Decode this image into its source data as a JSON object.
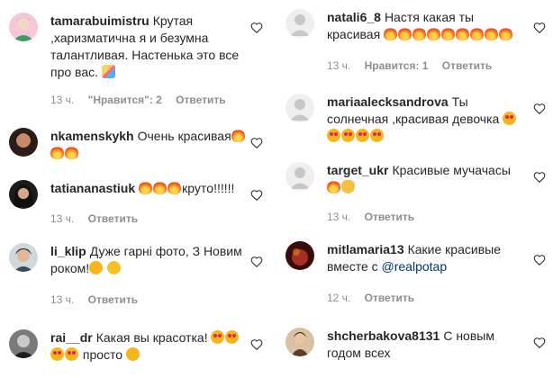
{
  "left_comments": [
    {
      "username": "tamarabuimistru",
      "text": "Крутая ,харизматична я и безумна талантливая. Настенька это все про вас.",
      "emojis": [
        "party-popper-icon"
      ],
      "time": "13 ч.",
      "likes": "\"Нравится\": 2",
      "reply": "Ответить",
      "avatar_colors": [
        "#f6c7d8",
        "#3a9a6a"
      ]
    },
    {
      "username": "nkamenskykh",
      "text": "Очень красивая",
      "emojis": [
        "fire-icon",
        "fire-icon",
        "fire-icon"
      ],
      "time": "",
      "likes": "",
      "reply": "",
      "avatar_colors": [
        "#2b1d1a",
        "#9a5b3c"
      ]
    },
    {
      "username": "tatiananastiuk",
      "text": "крутo!!!!!!",
      "emojis_before": [
        "fire-icon",
        "fire-icon",
        "fire-icon"
      ],
      "time": "13 ч.",
      "likes": "",
      "reply": "Ответить",
      "avatar_colors": [
        "#1c1c1c",
        "#6b5a4e"
      ]
    },
    {
      "username": "li_klip",
      "text": "Дуже гарні фото, З Новим роком!",
      "emojis": [
        "smiling-face-icon",
        "smirk-face-icon"
      ],
      "time": "13 ч.",
      "likes": "",
      "reply": "Ответить",
      "avatar_colors": [
        "#cfd8dc",
        "#3b4a55"
      ]
    },
    {
      "username": "rai__dr",
      "text": "Какая вы красотка!",
      "emojis": [
        "heart-eyes-icon",
        "heart-eyes-icon",
        "heart-eyes-icon",
        "heart-eyes-icon"
      ],
      "text2": "просто",
      "emojis2": [
        "kiss-face-icon"
      ],
      "time": "",
      "likes": "",
      "reply": "",
      "avatar_colors": [
        "#1e1e1e",
        "#7a7a7a"
      ]
    }
  ],
  "right_comments": [
    {
      "username": "natali6_8",
      "text": "Настя какая ты красивая",
      "emojis": [
        "fire-icon",
        "fire-icon",
        "fire-icon",
        "fire-icon",
        "fire-icon",
        "fire-icon",
        "fire-icon",
        "fire-icon",
        "fire-icon"
      ],
      "time": "13 ч.",
      "likes": "Нравится: 1",
      "reply": "Ответить",
      "avatar_colors": [
        "#dbdbdb",
        "#c7c7c7"
      ]
    },
    {
      "username": "mariaalecksandrova",
      "text": "Ты солнечная ,красивая девочка",
      "emojis": [
        "heart-eyes-icon",
        "heart-eyes-icon",
        "heart-eyes-icon",
        "heart-eyes-icon",
        "heart-eyes-icon"
      ],
      "time": "13 ч.",
      "likes": "",
      "reply": "Ответить",
      "avatar_colors": [
        "#dbdbdb",
        "#c7c7c7"
      ]
    },
    {
      "username": "target_ukr",
      "text": "Красивые мучачасы",
      "emojis": [
        "fire-icon",
        "clap-icon"
      ],
      "time": "13 ч.",
      "likes": "",
      "reply": "Ответить",
      "avatar_colors": [
        "#dbdbdb",
        "#c7c7c7"
      ]
    },
    {
      "username": "mitlamaria13",
      "text": "Какие красивые вместе с",
      "mention": "@realpotap",
      "time": "12 ч.",
      "likes": "",
      "reply": "Ответить",
      "avatar_colors": [
        "#3a0d0d",
        "#c0392b"
      ]
    },
    {
      "username": "shcherbakova8131",
      "text": "С новым годом всех",
      "time": "",
      "likes": "",
      "reply": "",
      "avatar_colors": [
        "#d9c2a3",
        "#5a3d2a"
      ]
    }
  ]
}
